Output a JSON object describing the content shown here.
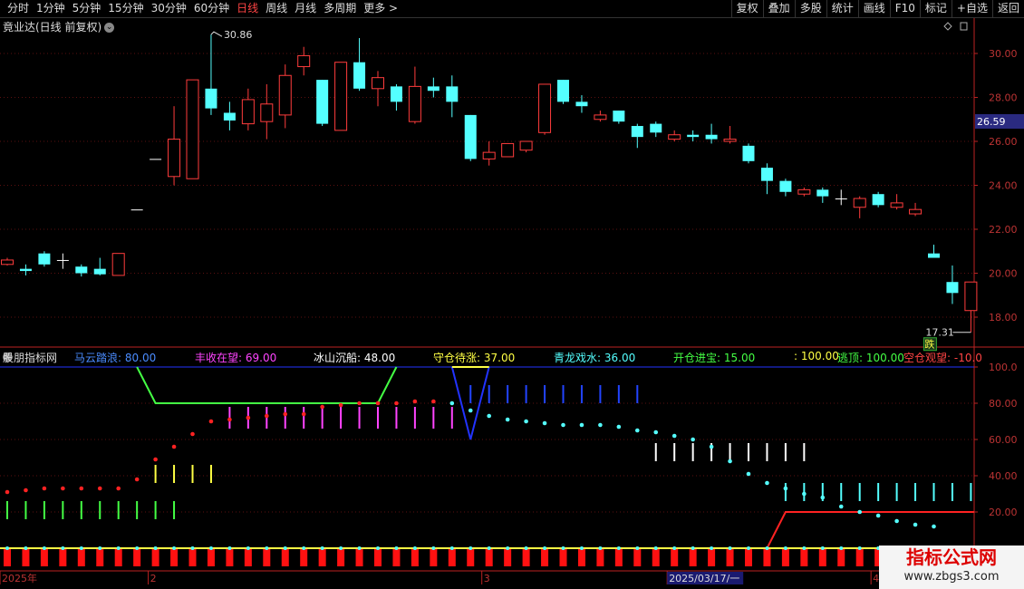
{
  "toolbar": {
    "periods": [
      "分时",
      "1分钟",
      "5分钟",
      "15分钟",
      "30分钟",
      "60分钟",
      "日线",
      "周线",
      "月线",
      "多周期",
      "更多 >"
    ],
    "active_period": "日线",
    "buttons": [
      "复权",
      "叠加",
      "多股",
      "统计",
      "画线",
      "F10",
      "标记",
      "+自选",
      "返回"
    ]
  },
  "main_chart": {
    "title": "竟业达(日线 前复权)",
    "high_label": "30.86",
    "low_label": "17.31",
    "price_badge": "26.59",
    "fall_tag": "跌",
    "y_ticks": [
      "30.00",
      "28.00",
      "26.00",
      "24.00",
      "22.00",
      "20.00",
      "18.00"
    ],
    "colors": {
      "up": "#ff3c3c",
      "down": "#54ffff",
      "flat": "#ffffff"
    },
    "candles": [
      {
        "o": 20.4,
        "c": 20.6,
        "h": 20.7,
        "l": 20.35
      },
      {
        "o": 20.2,
        "c": 20.1,
        "h": 20.4,
        "l": 19.9
      },
      {
        "o": 20.9,
        "c": 20.4,
        "h": 21.0,
        "l": 20.3
      },
      {
        "o": 20.6,
        "c": 20.6,
        "h": 20.9,
        "l": 20.2
      },
      {
        "o": 20.3,
        "c": 20.0,
        "h": 20.4,
        "l": 19.85
      },
      {
        "o": 20.2,
        "c": 19.95,
        "h": 20.7,
        "l": 19.9
      },
      {
        "o": 19.9,
        "c": 20.9,
        "h": 20.9,
        "l": 19.9
      },
      {
        "o": 22.9,
        "c": 22.9,
        "h": 22.9,
        "l": 22.9
      },
      {
        "o": 25.2,
        "c": 25.2,
        "h": 25.2,
        "l": 25.2
      },
      {
        "o": 24.4,
        "c": 26.1,
        "h": 27.6,
        "l": 24.0
      },
      {
        "o": 24.3,
        "c": 28.8,
        "h": 28.8,
        "l": 24.3
      },
      {
        "o": 28.4,
        "c": 27.5,
        "h": 30.86,
        "l": 27.2
      },
      {
        "o": 27.3,
        "c": 26.95,
        "h": 27.8,
        "l": 26.5
      },
      {
        "o": 26.8,
        "c": 27.9,
        "h": 28.4,
        "l": 26.5
      },
      {
        "o": 26.9,
        "c": 27.7,
        "h": 28.6,
        "l": 26.1
      },
      {
        "o": 27.2,
        "c": 29.0,
        "h": 29.5,
        "l": 26.6
      },
      {
        "o": 29.4,
        "c": 29.9,
        "h": 30.3,
        "l": 29.0
      },
      {
        "o": 28.8,
        "c": 26.8,
        "h": 28.8,
        "l": 26.7
      },
      {
        "o": 26.5,
        "c": 29.6,
        "h": 29.6,
        "l": 26.5
      },
      {
        "o": 29.6,
        "c": 28.4,
        "h": 30.7,
        "l": 28.3
      },
      {
        "o": 28.4,
        "c": 28.9,
        "h": 29.2,
        "l": 27.6
      },
      {
        "o": 28.5,
        "c": 27.8,
        "h": 28.6,
        "l": 27.4
      },
      {
        "o": 26.9,
        "c": 28.5,
        "h": 29.4,
        "l": 26.8
      },
      {
        "o": 28.5,
        "c": 28.3,
        "h": 28.9,
        "l": 28.0
      },
      {
        "o": 28.5,
        "c": 27.8,
        "h": 29.0,
        "l": 27.1
      },
      {
        "o": 27.2,
        "c": 25.2,
        "h": 27.2,
        "l": 25.1
      },
      {
        "o": 25.2,
        "c": 25.5,
        "h": 26.0,
        "l": 24.9
      },
      {
        "o": 25.3,
        "c": 25.9,
        "h": 25.9,
        "l": 25.3
      },
      {
        "o": 25.6,
        "c": 26.0,
        "h": 26.0,
        "l": 25.5
      },
      {
        "o": 26.4,
        "c": 28.6,
        "h": 28.6,
        "l": 26.3
      },
      {
        "o": 28.8,
        "c": 27.8,
        "h": 28.8,
        "l": 27.7
      },
      {
        "o": 27.8,
        "c": 27.6,
        "h": 28.1,
        "l": 27.3
      },
      {
        "o": 27.0,
        "c": 27.2,
        "h": 27.4,
        "l": 26.9
      },
      {
        "o": 27.4,
        "c": 26.9,
        "h": 27.4,
        "l": 26.8
      },
      {
        "o": 26.7,
        "c": 26.2,
        "h": 26.8,
        "l": 25.7
      },
      {
        "o": 26.8,
        "c": 26.4,
        "h": 26.9,
        "l": 26.2
      },
      {
        "o": 26.1,
        "c": 26.3,
        "h": 26.5,
        "l": 26.0
      },
      {
        "o": 26.3,
        "c": 26.2,
        "h": 26.5,
        "l": 26.0
      },
      {
        "o": 26.3,
        "c": 26.1,
        "h": 26.8,
        "l": 25.9
      },
      {
        "o": 26.0,
        "c": 26.1,
        "h": 26.7,
        "l": 25.9
      },
      {
        "o": 25.8,
        "c": 25.1,
        "h": 25.9,
        "l": 25.0
      },
      {
        "o": 24.8,
        "c": 24.2,
        "h": 25.0,
        "l": 23.6
      },
      {
        "o": 24.2,
        "c": 23.7,
        "h": 24.3,
        "l": 23.5
      },
      {
        "o": 23.6,
        "c": 23.8,
        "h": 23.9,
        "l": 23.5
      },
      {
        "o": 23.8,
        "c": 23.5,
        "h": 23.9,
        "l": 23.2
      },
      {
        "o": 23.4,
        "c": 23.4,
        "h": 23.8,
        "l": 23.1
      },
      {
        "o": 23.0,
        "c": 23.4,
        "h": 23.5,
        "l": 22.5
      },
      {
        "o": 23.6,
        "c": 23.1,
        "h": 23.7,
        "l": 23.0
      },
      {
        "o": 23.0,
        "c": 23.2,
        "h": 23.6,
        "l": 22.9
      },
      {
        "o": 22.7,
        "c": 22.9,
        "h": 23.2,
        "l": 22.6
      },
      {
        "o": 20.9,
        "c": 20.7,
        "h": 21.3,
        "l": 20.7
      },
      {
        "o": 19.6,
        "c": 19.1,
        "h": 20.35,
        "l": 18.6
      },
      {
        "o": 18.3,
        "c": 19.6,
        "h": 19.6,
        "l": 17.31
      }
    ]
  },
  "indicator": {
    "title": "股朋指标网",
    "labels": [
      {
        "text": "马云踏浪: 80.00",
        "color": "#4a8cff"
      },
      {
        "text": "丰收在望: 69.00",
        "color": "#ff44ff"
      },
      {
        "text": "冰山沉船: 48.00",
        "color": "#ffffff"
      },
      {
        "text": "守仓待涨: 37.00",
        "color": "#ffff44"
      },
      {
        "text": "青龙戏水: 36.00",
        "color": "#54ffff"
      },
      {
        "text": "开仓进宝: 15.00",
        "color": "#44ff44"
      },
      {
        "text": ": 100.00",
        "color": "#ffff44"
      },
      {
        "text": "逃顶: 100.00",
        "color": "#44ff44"
      },
      {
        "text": "空仓观望: -10.0",
        "color": "#ff4444"
      }
    ],
    "y_ticks": [
      "100.0",
      "80.00",
      "60.00",
      "40.00",
      "20.00"
    ],
    "dots": [
      31,
      32,
      33,
      33,
      33,
      33,
      33,
      38,
      49,
      56,
      63,
      70,
      71,
      72,
      73,
      74,
      74,
      78,
      79,
      80,
      80,
      80,
      81,
      81,
      80,
      76,
      73,
      71,
      70,
      69,
      68,
      68,
      68,
      67,
      65,
      64,
      62,
      60,
      56,
      48,
      41,
      36,
      33,
      30,
      28,
      23,
      20,
      18,
      15,
      13,
      12
    ],
    "dot_colors": [
      "red",
      "red",
      "red",
      "red",
      "red",
      "red",
      "red",
      "red",
      "red",
      "red",
      "red",
      "red",
      "red",
      "red",
      "red",
      "red",
      "red",
      "red",
      "red",
      "red",
      "red",
      "red",
      "red",
      "red",
      "cyan",
      "cyan",
      "cyan",
      "cyan",
      "cyan",
      "cyan",
      "cyan",
      "cyan",
      "cyan",
      "cyan",
      "cyan",
      "cyan",
      "cyan",
      "cyan",
      "cyan",
      "cyan",
      "cyan",
      "cyan",
      "cyan",
      "cyan",
      "cyan",
      "cyan",
      "cyan",
      "cyan",
      "cyan",
      "cyan",
      "cyan"
    ],
    "bar_groups": [
      {
        "color": "#44ff44",
        "from": 0,
        "to": 9,
        "y1": 26,
        "y2": 16
      },
      {
        "color": "#ffff44",
        "from": 8,
        "to": 11,
        "y1": 46,
        "y2": 36
      },
      {
        "color": "#ff44ff",
        "from": 12,
        "to": 24,
        "y1": 78,
        "y2": 66
      },
      {
        "color": "#2244ff",
        "from": 25,
        "to": 34,
        "y1": 90,
        "y2": 80
      },
      {
        "color": "#ffffff",
        "from": 35,
        "to": 43,
        "y1": 58,
        "y2": 48
      },
      {
        "color": "#54ffff",
        "from": 42,
        "to": 52,
        "y1": 36,
        "y2": 26
      }
    ]
  },
  "x_axis": {
    "labels": [
      {
        "text": "2025年",
        "bar": 0
      },
      {
        "text": "2",
        "bar": 8
      },
      {
        "text": "3",
        "bar": 26
      },
      {
        "text": "2025/03/17/一",
        "bar": 36
      },
      {
        "text": "4",
        "bar": 47
      }
    ]
  },
  "watermark": {
    "line1": "指标公式网",
    "line2": "www.zbgs3.com"
  }
}
